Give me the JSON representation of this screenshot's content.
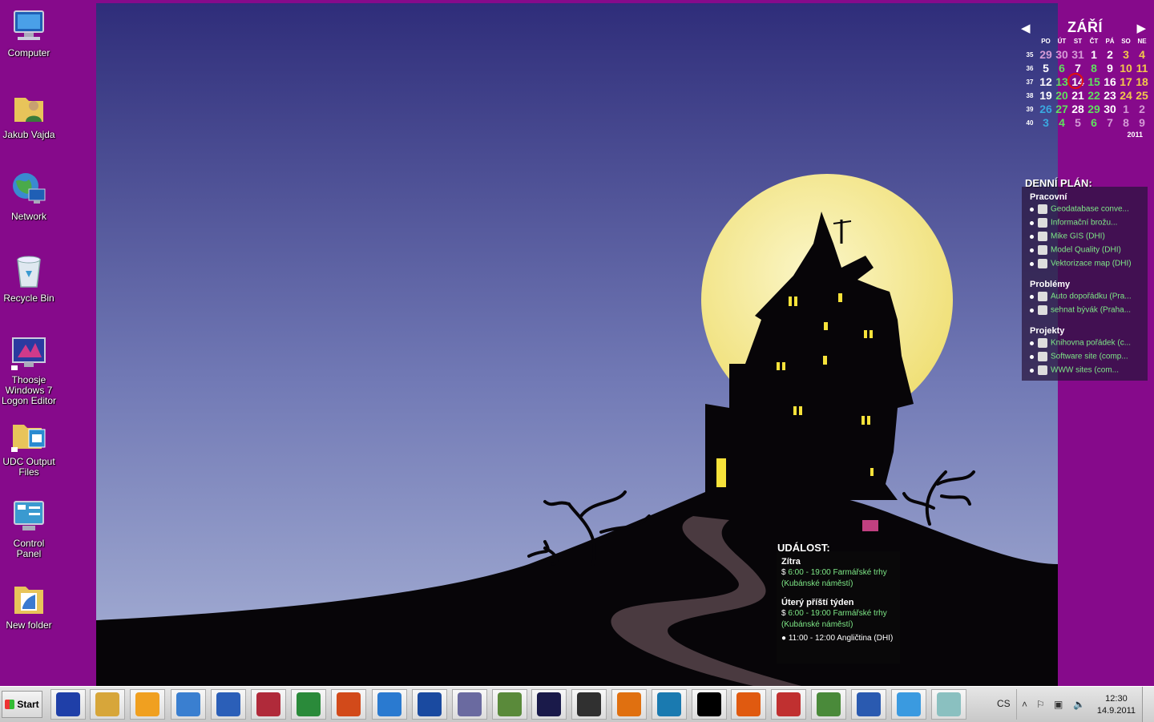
{
  "desktop_icons": [
    {
      "name": "computer",
      "label": "Computer",
      "icon": "computer-icon"
    },
    {
      "name": "user-folder",
      "label": "Jakub Vajda",
      "icon": "user-folder-icon"
    },
    {
      "name": "network",
      "label": "Network",
      "icon": "network-icon"
    },
    {
      "name": "recycle-bin",
      "label": "Recycle Bin",
      "icon": "recycle-bin-icon"
    },
    {
      "name": "logon-editor",
      "label": "Thoosje Windows 7 Logon Editor",
      "icon": "logon-editor-icon"
    },
    {
      "name": "udc-output",
      "label": "UDC Output Files",
      "icon": "folder-shortcut-icon"
    },
    {
      "name": "control-panel",
      "label": "Control Panel",
      "icon": "control-panel-icon"
    },
    {
      "name": "new-folder",
      "label": "New folder",
      "icon": "folder-icon"
    }
  ],
  "calendar": {
    "month": "ZÁŘÍ",
    "year": "2011",
    "weekdays": [
      "PO",
      "ÚT",
      "ST",
      "ČT",
      "PÁ",
      "SO",
      "NE"
    ],
    "weeks": [
      {
        "num": "35",
        "days": [
          "29",
          "30",
          "31",
          "1",
          "2",
          "3",
          "4"
        ]
      },
      {
        "num": "36",
        "days": [
          "5",
          "6",
          "7",
          "8",
          "9",
          "10",
          "11"
        ]
      },
      {
        "num": "37",
        "days": [
          "12",
          "13",
          "14",
          "15",
          "16",
          "17",
          "18"
        ]
      },
      {
        "num": "38",
        "days": [
          "19",
          "20",
          "21",
          "22",
          "23",
          "24",
          "25"
        ]
      },
      {
        "num": "39",
        "days": [
          "26",
          "27",
          "28",
          "29",
          "30",
          "1",
          "2"
        ]
      },
      {
        "num": "40",
        "days": [
          "3",
          "4",
          "5",
          "6",
          "7",
          "8",
          "9"
        ]
      }
    ],
    "today": "14",
    "colors": {
      "normal": "#ffffff",
      "weekend": "#f2c84b",
      "other_month": "#d49ad6",
      "event": "#5fe05f",
      "today_ring": "#e01010"
    }
  },
  "daily_plan": {
    "title": "DENNÍ PLÁN:",
    "sections": [
      {
        "name": "Pracovní",
        "items": [
          "Geodatabase conve...",
          "Informační brožu...",
          "Mike GIS (DHI)",
          "Model Quality (DHI)",
          "Vektorizace map (DHI)"
        ]
      },
      {
        "name": "Problémy",
        "items": [
          "Auto dopořádku (Pra...",
          "sehnat bývák (Praha..."
        ]
      },
      {
        "name": "Projekty",
        "items": [
          "Knihovna pořádek (c...",
          "Software site (comp...",
          "WWW sites (com..."
        ]
      }
    ]
  },
  "event_gadget": {
    "title": "UDÁLOST:",
    "groups": [
      {
        "heading": "Zítra",
        "events": [
          "6:00 - 19:00 Farmářské trhy (Kubánské náměstí)"
        ]
      },
      {
        "heading": "Úterý příští týden",
        "events": [
          "6:00 - 19:00 Farmářské trhy (Kubánské náměstí)",
          "11:00 - 12:00 Angličtina (DHI)"
        ]
      }
    ]
  },
  "taskbar": {
    "start_label": "Start",
    "pinned": [
      {
        "name": "save-app",
        "icon": "floppy-disk-icon",
        "color": "#1f3fa8"
      },
      {
        "name": "explorer",
        "icon": "folder-icon",
        "color": "#d7a63a"
      },
      {
        "name": "outlook",
        "icon": "outlook-icon",
        "color": "#f0a020"
      },
      {
        "name": "remote-desktop",
        "icon": "remote-desktop-icon",
        "color": "#3a7fd0"
      },
      {
        "name": "word",
        "icon": "word-icon",
        "color": "#2b5fb8"
      },
      {
        "name": "access",
        "icon": "access-icon",
        "color": "#b02a3a"
      },
      {
        "name": "excel",
        "icon": "excel-icon",
        "color": "#2a8a3a"
      },
      {
        "name": "powerpoint",
        "icon": "powerpoint-icon",
        "color": "#d24a1a"
      },
      {
        "name": "internet-explorer",
        "icon": "ie-icon",
        "color": "#2a7ad0"
      },
      {
        "name": "google-earth",
        "icon": "globe-icon",
        "color": "#1a4aa0"
      },
      {
        "name": "network-tool",
        "icon": "network-tool-icon",
        "color": "#6a6aa0"
      },
      {
        "name": "windows-app",
        "icon": "windows-icon",
        "color": "#5a8a3a"
      },
      {
        "name": "stellarium",
        "icon": "night-sky-icon",
        "color": "#1a1a4a"
      },
      {
        "name": "alien-app",
        "icon": "alien-icon",
        "color": "#303030"
      },
      {
        "name": "n-app",
        "icon": "n-icon",
        "color": "#e07010"
      },
      {
        "name": "search-app",
        "icon": "magnifier-icon",
        "color": "#1a7ab0"
      },
      {
        "name": "command-prompt",
        "icon": "terminal-icon",
        "color": "#000000"
      },
      {
        "name": "firefox",
        "icon": "firefox-icon",
        "color": "#e05a10"
      },
      {
        "name": "filezilla-app",
        "icon": "split-icon",
        "color": "#c03030"
      },
      {
        "name": "gis-app",
        "icon": "g-document-icon",
        "color": "#4a8a3a"
      },
      {
        "name": "r-app",
        "icon": "r-icon",
        "color": "#2a5ab0"
      },
      {
        "name": "safari-app",
        "icon": "compass-icon",
        "color": "#3a9ae0"
      },
      {
        "name": "notes-app",
        "icon": "notepad-icon",
        "color": "#8ac0c0"
      }
    ],
    "language": "CS",
    "clock_time": "12:30",
    "clock_date": "14.9.2011"
  }
}
